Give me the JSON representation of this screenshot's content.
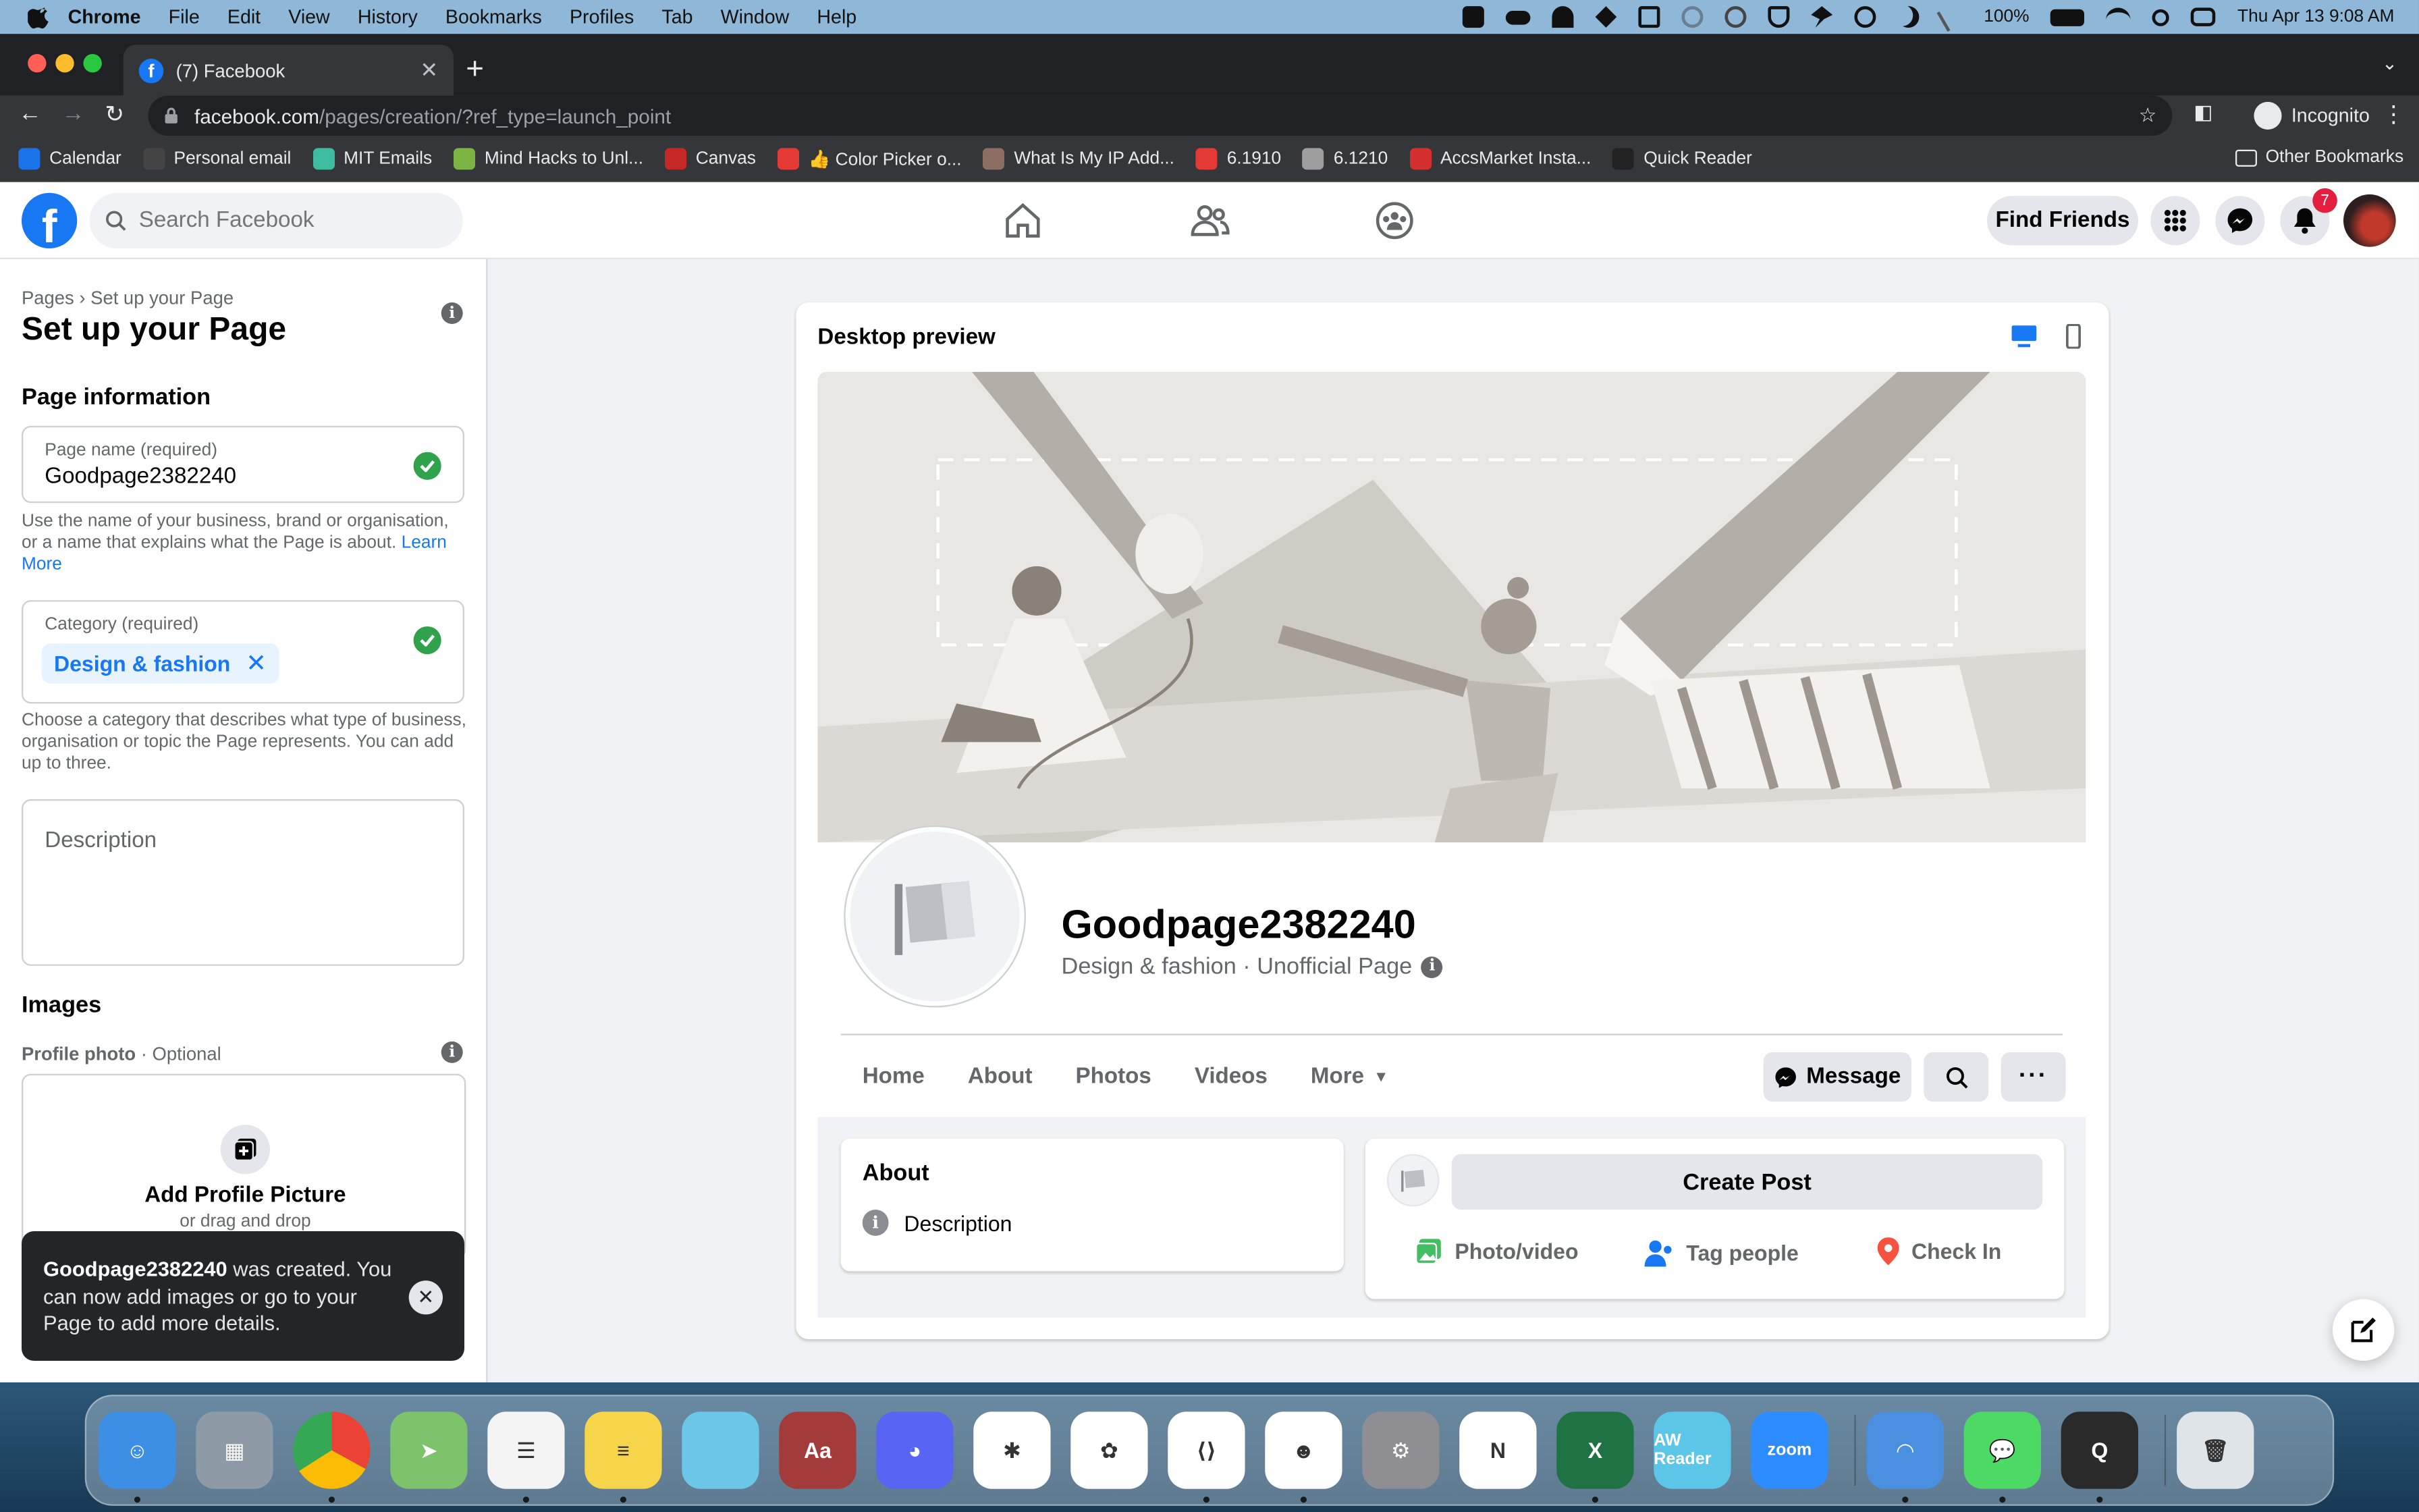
{
  "menubar": {
    "app": "Chrome",
    "items": [
      "File",
      "Edit",
      "View",
      "History",
      "Bookmarks",
      "Profiles",
      "Tab",
      "Window",
      "Help"
    ],
    "battery": "100%",
    "datetime": "Thu Apr 13  9:08 AM"
  },
  "browser": {
    "tab_title": "(7) Facebook",
    "url_host": "facebook.com",
    "url_path": "/pages/creation/?ref_type=launch_point",
    "profile": "Incognito",
    "bookmarks": [
      {
        "label": "Calendar",
        "color": "#1a73e8"
      },
      {
        "label": "Personal email",
        "color": "#444444"
      },
      {
        "label": "MIT Emails",
        "color": "#3dbca0"
      },
      {
        "label": "Mind Hacks to Unl...",
        "color": "#7cb342"
      },
      {
        "label": "Canvas",
        "color": "#c62828"
      },
      {
        "label": "👍 Color Picker o...",
        "color": "#e53935"
      },
      {
        "label": "What Is My IP Add...",
        "color": "#8d6e63"
      },
      {
        "label": "6.1910",
        "color": "#e53935"
      },
      {
        "label": "6.1210",
        "color": "#9e9e9e"
      },
      {
        "label": "AccsMarket Insta...",
        "color": "#d32f2f"
      },
      {
        "label": "Quick Reader",
        "color": "#222222"
      }
    ],
    "other_bookmarks": "Other Bookmarks"
  },
  "fb": {
    "search_placeholder": "Search Facebook",
    "find_friends": "Find Friends",
    "notif_count": "7"
  },
  "setup": {
    "breadcrumb": "Pages › Set up your Page",
    "title": "Set up your Page",
    "page_info_heading": "Page information",
    "page_name_label": "Page name (required)",
    "page_name_value": "Goodpage2382240",
    "page_name_help": "Use the name of your business, brand or organisation, or a name that explains what the Page is about.",
    "learn_more": "Learn More",
    "category_label": "Category (required)",
    "category_chip": "Design & fashion",
    "category_help": "Choose a category that describes what type of business, organisation or topic the Page represents. You can add up to three.",
    "description_placeholder": "Description",
    "images_heading": "Images",
    "profile_photo_label": "Profile photo",
    "profile_photo_optional": " · Optional",
    "add_profile_picture": "Add Profile Picture",
    "drag_drop": "or drag and drop"
  },
  "toast": {
    "page_name": "Goodpage2382240",
    "message": " was created. You can now add images or go to your Page to add more details."
  },
  "preview": {
    "heading": "Desktop preview",
    "page_name": "Goodpage2382240",
    "page_subtitle": "Design & fashion · Unofficial Page",
    "tabs": [
      "Home",
      "About",
      "Photos",
      "Videos",
      "More"
    ],
    "message_button": "Message",
    "about_heading": "About",
    "about_description": "Description",
    "create_post": "Create Post",
    "actions": [
      "Photo/video",
      "Tag people",
      "Check In"
    ]
  },
  "colors": {
    "fb_blue": "#1877f2",
    "check_green": "#31a24c",
    "notif_red": "#e41e3f"
  },
  "dock": {
    "apps": [
      {
        "name": "Finder",
        "icon": "finder-icon",
        "color": "#3d8fe6",
        "glyph": "☺"
      },
      {
        "name": "Launchpad",
        "icon": "launchpad-icon",
        "color": "#8e9aa6",
        "glyph": "▦"
      },
      {
        "name": "Chrome",
        "icon": "chrome-icon",
        "color": "#e6e6e6",
        "glyph": ""
      },
      {
        "name": "Maps",
        "icon": "maps-icon",
        "color": "#7cc36b",
        "glyph": "➤"
      },
      {
        "name": "Reminders",
        "icon": "reminders-icon",
        "color": "#f4f4f4",
        "glyph": "☰"
      },
      {
        "name": "Notes",
        "icon": "notes-icon",
        "color": "#f7d54a",
        "glyph": "≡"
      },
      {
        "name": "Stickies",
        "icon": "stickies-icon",
        "color": "#6bc6e8",
        "glyph": ""
      },
      {
        "name": "Dictionary",
        "icon": "dictionary-icon",
        "color": "#a33b3b",
        "glyph": "Aa"
      },
      {
        "name": "Discord",
        "icon": "discord-icon",
        "color": "#5865f2",
        "glyph": "◕"
      },
      {
        "name": "Slack",
        "icon": "slack-icon",
        "color": "#ffffff",
        "glyph": "✱"
      },
      {
        "name": "Photos",
        "icon": "photos-icon",
        "color": "#ffffff",
        "glyph": "✿"
      },
      {
        "name": "VS Code",
        "icon": "vscode-icon",
        "color": "#ffffff",
        "glyph": "⟨⟩"
      },
      {
        "name": "Bear",
        "icon": "beaver-icon",
        "color": "#ffffff",
        "glyph": "☻"
      },
      {
        "name": "System Settings",
        "icon": "settings-icon",
        "color": "#8e8e93",
        "glyph": "⚙"
      },
      {
        "name": "Notion",
        "icon": "notion-icon",
        "color": "#ffffff",
        "glyph": "N"
      },
      {
        "name": "Excel",
        "icon": "excel-icon",
        "color": "#1f7244",
        "glyph": "X"
      },
      {
        "name": "AW Reader",
        "icon": "aw-reader-icon",
        "color": "#5cc6e8",
        "glyph": "AW Reader"
      },
      {
        "name": "Zoom",
        "icon": "zoom-icon",
        "color": "#2d8cff",
        "glyph": "zoom"
      },
      {
        "name": "Sep",
        "icon": "separator",
        "color": "",
        "glyph": ""
      },
      {
        "name": "Copilot",
        "icon": "copilot-icon",
        "color": "#4a8fe0",
        "glyph": "◠"
      },
      {
        "name": "Messages",
        "icon": "messages-icon",
        "color": "#4cd964",
        "glyph": "💬"
      },
      {
        "name": "QuickTime",
        "icon": "quicktime-icon",
        "color": "#2a2a2a",
        "glyph": "Q"
      },
      {
        "name": "Sep2",
        "icon": "separator",
        "color": "",
        "glyph": ""
      },
      {
        "name": "Trash",
        "icon": "trash-icon",
        "color": "#dfe4e8",
        "glyph": "🗑"
      }
    ]
  }
}
